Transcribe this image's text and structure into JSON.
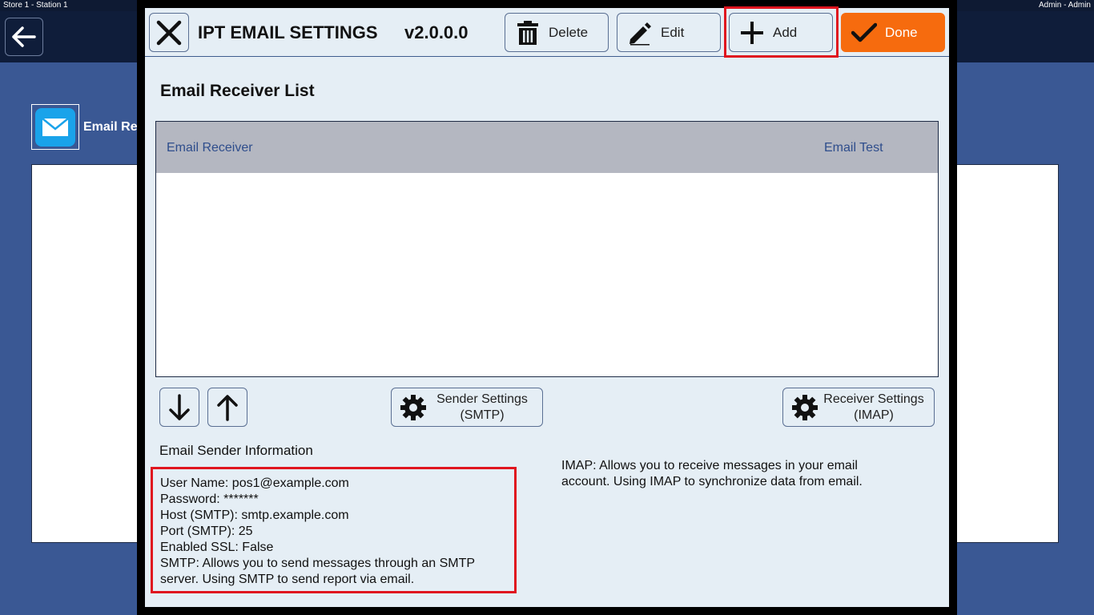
{
  "topbar": {
    "left": "Store 1 - Station 1",
    "right": "Admin - Admin"
  },
  "background": {
    "page_title": "Email Re"
  },
  "modal": {
    "title": "IPT EMAIL SETTINGS",
    "version": "v2.0.0.0",
    "buttons": {
      "delete": "Delete",
      "edit": "Edit",
      "add": "Add",
      "done": "Done"
    },
    "section_title": "Email Receiver List",
    "table": {
      "columns": [
        "Email Receiver",
        "Email Test"
      ],
      "rows": []
    },
    "sender_settings": {
      "line1": "Sender Settings",
      "line2": "(SMTP)"
    },
    "receiver_settings": {
      "line1": "Receiver Settings",
      "line2": "(IMAP)"
    },
    "sender_info_title": "Email Sender Information",
    "sender_info": {
      "user": "User Name: pos1@example.com",
      "password": "Password: *******",
      "host": "Host (SMTP): smtp.example.com",
      "port": "Port (SMTP): 25",
      "ssl": "Enabled SSL: False",
      "smtp_note_1": "SMTP: Allows you to send messages through an SMTP",
      "smtp_note_2": "server. Using SMTP to send report via email."
    },
    "imap_note_1": "IMAP: Allows you to receive messages in your email",
    "imap_note_2": "account. Using IMAP to synchronize data from email."
  },
  "colors": {
    "accent_done": "#f66b0e",
    "highlight": "#e0141e",
    "header_text": "#2e4d8c"
  },
  "icons": [
    "back-arrow-icon",
    "mail-icon",
    "close-icon",
    "trash-icon",
    "pencil-icon",
    "plus-icon",
    "check-icon",
    "arrow-down-icon",
    "arrow-up-icon",
    "gear-icon"
  ]
}
